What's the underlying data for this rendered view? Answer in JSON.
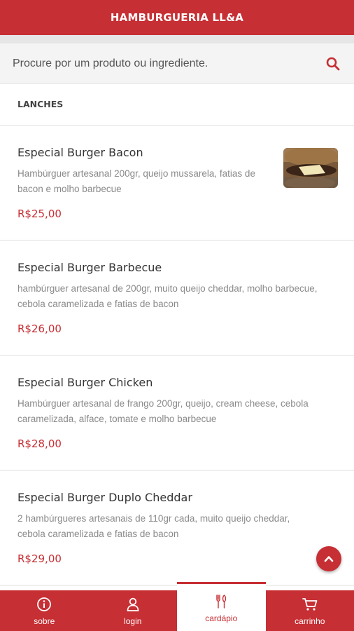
{
  "header": {
    "title": "HAMBURGUERIA LL&A"
  },
  "search": {
    "placeholder": "Procure por um produto ou ingrediente."
  },
  "section": {
    "title": "LANCHES"
  },
  "products": [
    {
      "name": "Especial Burger Bacon",
      "description": "Hambúrguer artesanal 200gr, queijo mussarela, fatias de bacon e molho barbecue",
      "price": "R$25,00"
    },
    {
      "name": "Especial Burger Barbecue",
      "description": "hambúrguer artesanal de 200gr, muito queijo cheddar, molho barbecue, cebola caramelizada e fatias de bacon",
      "price": "R$26,00"
    },
    {
      "name": "Especial Burger Chicken",
      "description": "Hambúrguer artesanal de frango 200gr, queijo, cream cheese, cebola caramelizada, alface, tomate e molho barbecue",
      "price": "R$28,00"
    },
    {
      "name": "Especial Burger Duplo Cheddar",
      "description": "2 hambúrgueres artesanais de 110gr cada, muito queijo cheddar, cebola caramelizada e fatias de bacon",
      "price": "R$29,00"
    }
  ],
  "nav": {
    "items": [
      {
        "label": "sobre",
        "icon": "info-icon"
      },
      {
        "label": "login",
        "icon": "user-icon"
      },
      {
        "label": "cardápio",
        "icon": "cutlery-icon",
        "active": true
      },
      {
        "label": "carrinho",
        "icon": "cart-icon"
      }
    ]
  },
  "colors": {
    "brand": "#c62f34",
    "muted_text": "#8a8a8a"
  }
}
